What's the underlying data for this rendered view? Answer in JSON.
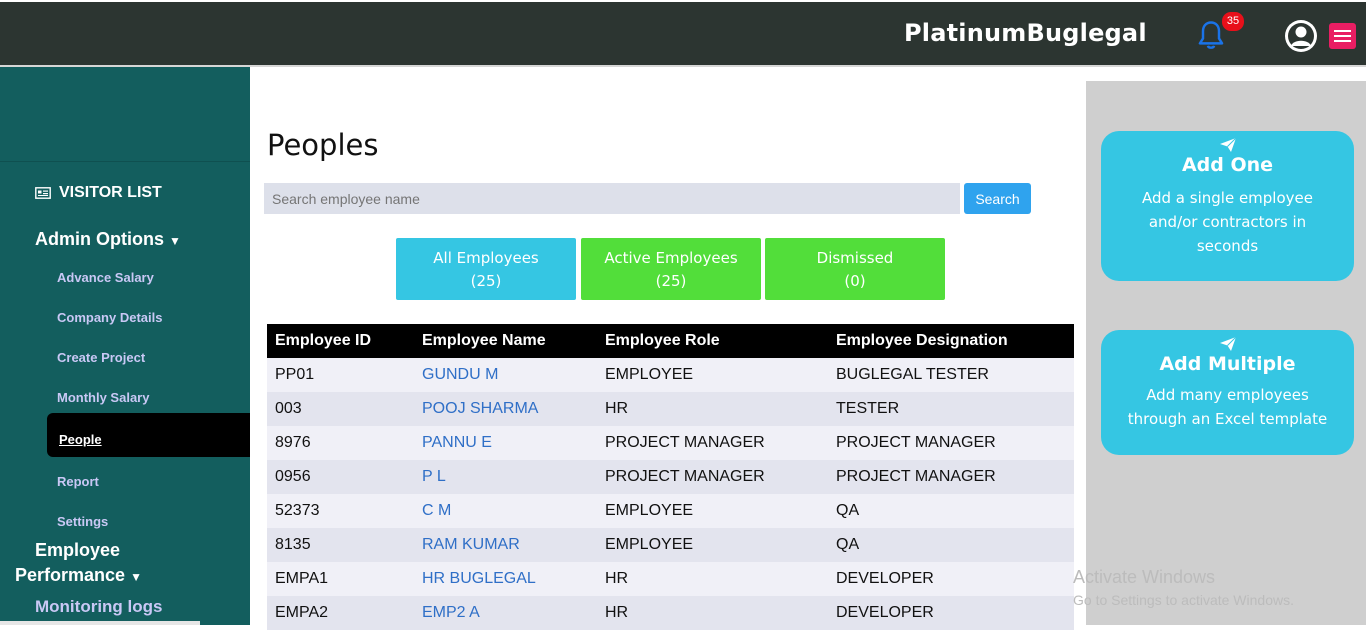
{
  "header": {
    "brand": "PlatinumBuglegal",
    "notification_count": "35",
    "icons": {
      "bell": "bell-icon",
      "avatar": "user-avatar-icon",
      "menu": "hamburger-menu-icon"
    },
    "colors": {
      "bar": "#2c3531",
      "bell": "#1a73e8",
      "badge": "#e8101a",
      "menu": "#e91e63"
    }
  },
  "sidebar": {
    "visitor_list": "VISITOR LIST",
    "admin_options": "Admin Options",
    "admin_items": [
      {
        "label": "Advance Salary"
      },
      {
        "label": "Company Details"
      },
      {
        "label": "Create Project"
      },
      {
        "label": "Monthly Salary"
      },
      {
        "label": "People",
        "active": true
      },
      {
        "label": "Report"
      },
      {
        "label": "Settings"
      }
    ],
    "employee_performance_1": "Employee",
    "employee_performance_2": "Performance",
    "monitoring_logs": "Monitoring logs",
    "colors": {
      "background": "#135e5e",
      "sub_item": "#c9c8f5"
    }
  },
  "main": {
    "title": "Peoples",
    "search": {
      "placeholder": "Search employee name",
      "button": "Search"
    },
    "filters": [
      {
        "label": "All Employees",
        "count": "(25)"
      },
      {
        "label": "Active Employees",
        "count": "(25)"
      },
      {
        "label": "Dismissed",
        "count": "(0)"
      }
    ],
    "table": {
      "headers": [
        "Employee ID",
        "Employee Name",
        "Employee Role",
        "Employee Designation"
      ],
      "rows": [
        [
          "PP01",
          "GUNDU M",
          "EMPLOYEE",
          "BUGLEGAL TESTER"
        ],
        [
          "003",
          "POOJ SHARMA",
          "HR",
          "TESTER"
        ],
        [
          "8976",
          "PANNU E",
          "PROJECT MANAGER",
          "PROJECT MANAGER"
        ],
        [
          "0956",
          "P L",
          "PROJECT MANAGER",
          "PROJECT MANAGER"
        ],
        [
          "52373",
          "C M",
          "EMPLOYEE",
          "QA"
        ],
        [
          "8135",
          "RAM KUMAR",
          "EMPLOYEE",
          "QA"
        ],
        [
          "EMPA1",
          "HR BUGLEGAL",
          "HR",
          "DEVELOPER"
        ],
        [
          "EMPA2",
          "EMP2 A",
          "HR",
          "DEVELOPER"
        ]
      ]
    }
  },
  "right_panel": {
    "add_one": {
      "title": "Add One",
      "desc": "Add a single employee and/or contractors in seconds"
    },
    "add_multiple": {
      "title": "Add Multiple",
      "desc": "Add many employees through an Excel template"
    }
  },
  "watermark": {
    "line1": "Activate Windows",
    "line2": "Go to Settings to activate Windows."
  }
}
